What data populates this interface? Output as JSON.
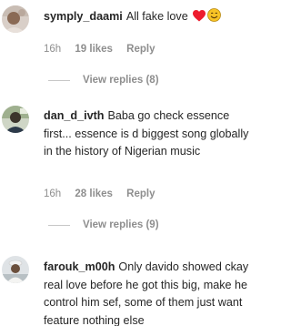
{
  "comments": [
    {
      "username": "symply_daami",
      "text": "All fake love",
      "time": "16h",
      "likes": "19 likes",
      "reply": "Reply",
      "view_replies": "View replies (8)",
      "emojis": [
        "red-heart-emoji",
        "smiling-face-emoji"
      ]
    },
    {
      "username": "dan_d_ivth",
      "text": "Baba go check essence first... essence is d biggest song globally in the history of Nigerian music",
      "time": "16h",
      "likes": "28 likes",
      "reply": "Reply",
      "view_replies": "View replies (9)"
    },
    {
      "username": "farouk_m00h",
      "text": "Only davido showed ckay real love before he got this big, make he control him sef, some of them just want feature nothing else"
    }
  ],
  "colors": {
    "text": "#262626",
    "secondary": "#8e8e8e",
    "divider": "#c7c7c7",
    "heart": "#ed1c2e",
    "smiley": "#f7c325"
  }
}
